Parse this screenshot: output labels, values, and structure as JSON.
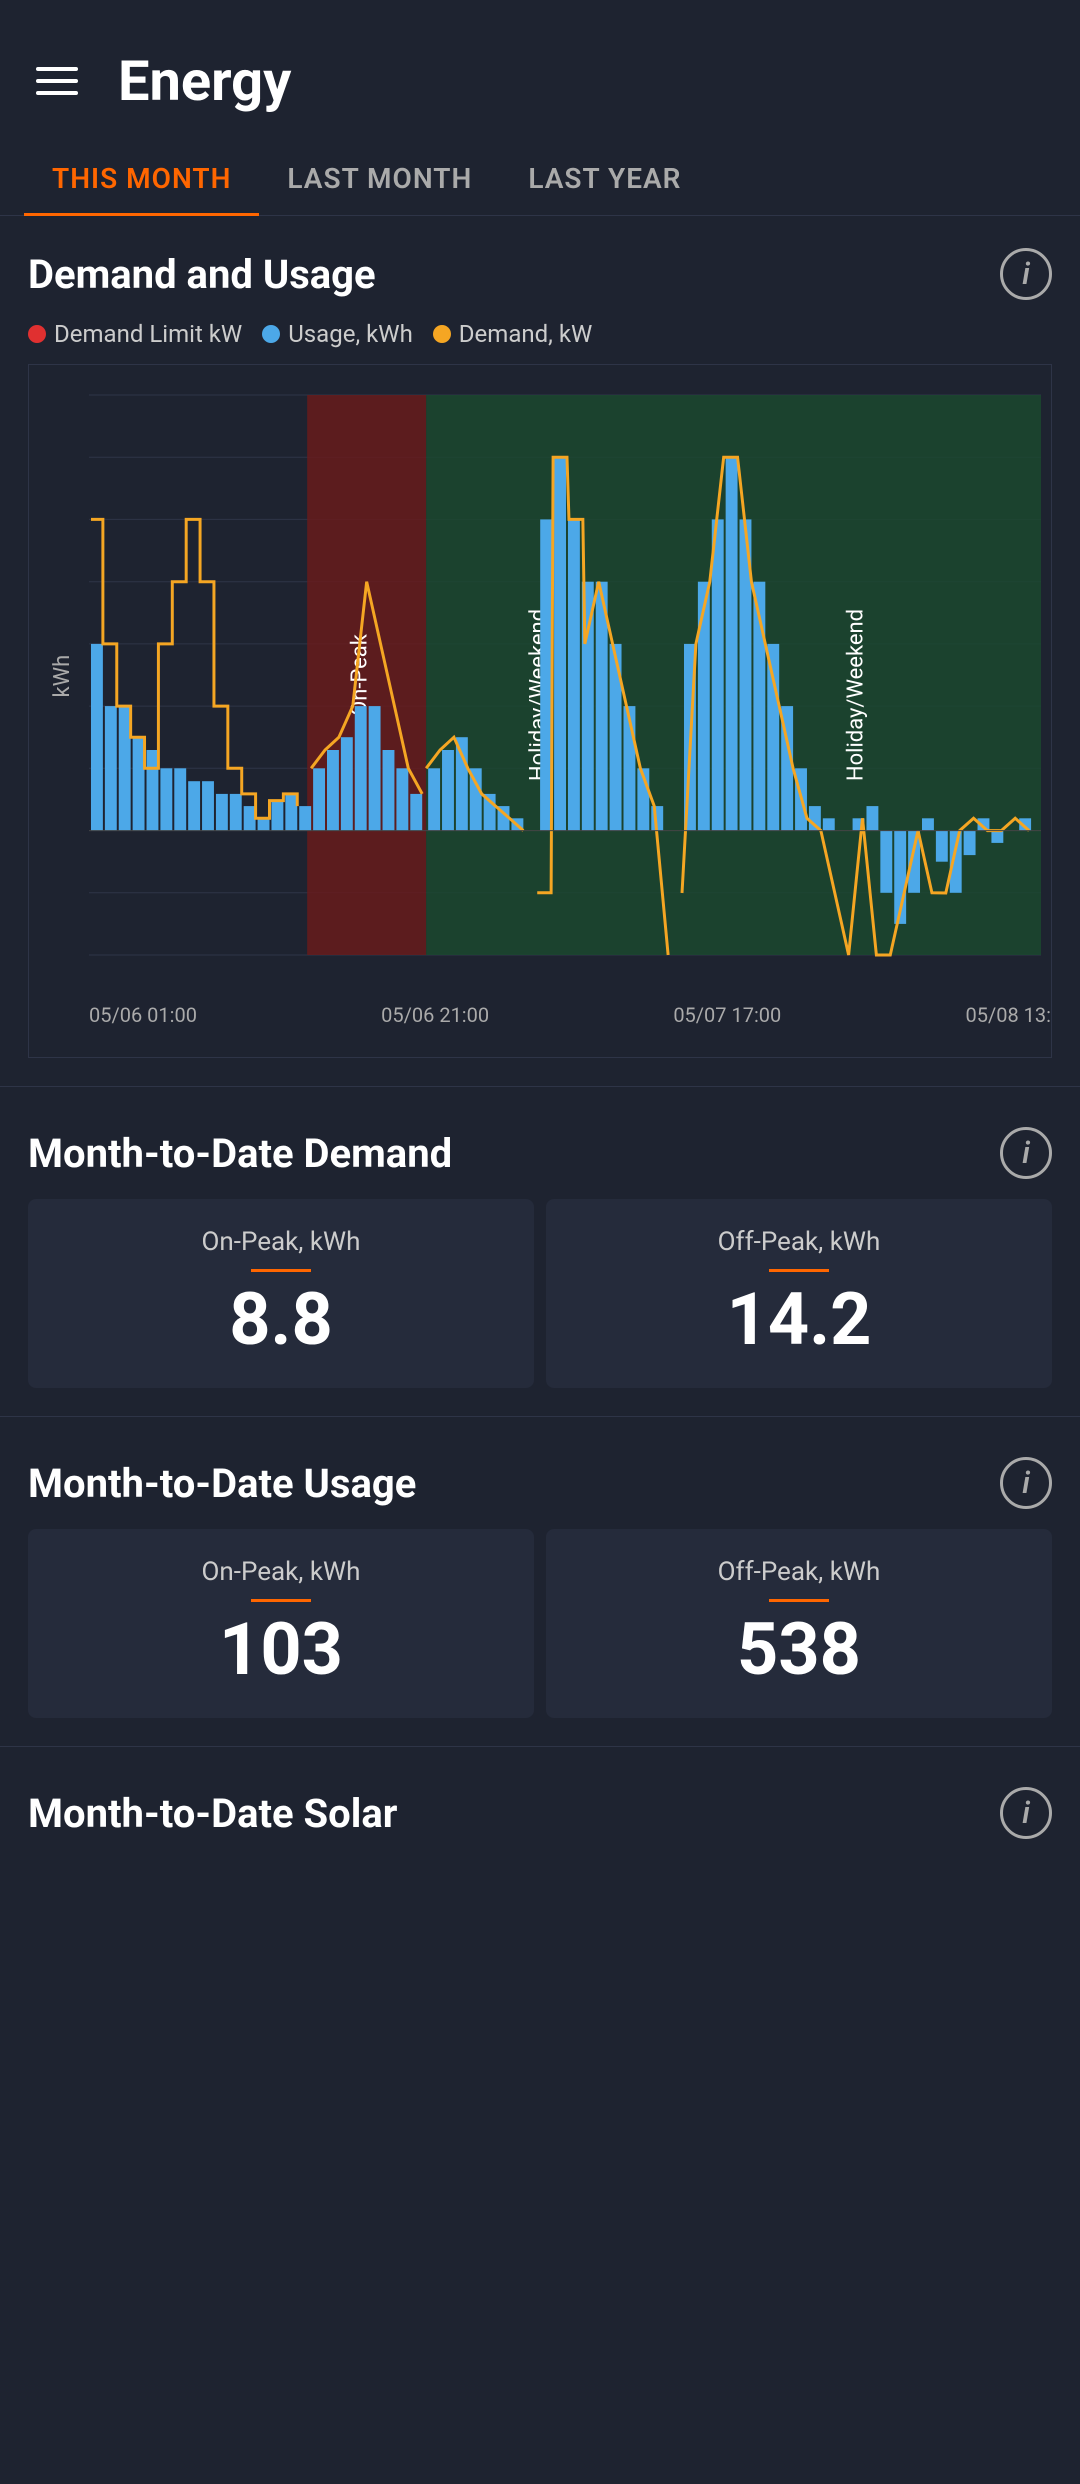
{
  "header": {
    "title": "Energy"
  },
  "tabs": [
    {
      "id": "this-month",
      "label": "THIS MONTH",
      "active": true
    },
    {
      "id": "last-month",
      "label": "LAST MONTH",
      "active": false
    },
    {
      "id": "last-year",
      "label": "LAST YEAR",
      "active": false
    }
  ],
  "demand_usage": {
    "title": "Demand and Usage",
    "legend": [
      {
        "label": "Demand Limit kW",
        "color": "#e03030"
      },
      {
        "label": "Usage, kWh",
        "color": "#4ca8e8"
      },
      {
        "label": "Demand, kW",
        "color": "#f5a623"
      }
    ],
    "y_axis_label": "kWh",
    "x_axis_labels": [
      "05/06 01:00",
      "05/06 21:00",
      "05/07 17:00",
      "05/08 13:"
    ],
    "zone_labels": [
      "On-Peak",
      "Holiday/Weekend",
      "Holiday/Weekend"
    ]
  },
  "month_to_date_demand": {
    "title": "Month-to-Date Demand",
    "on_peak_label": "On-Peak, kWh",
    "on_peak_value": "8.8",
    "off_peak_label": "Off-Peak, kWh",
    "off_peak_value": "14.2"
  },
  "month_to_date_usage": {
    "title": "Month-to-Date Usage",
    "on_peak_label": "On-Peak, kWh",
    "on_peak_value": "103",
    "off_peak_label": "Off-Peak, kWh",
    "off_peak_value": "538"
  },
  "month_to_date_solar": {
    "title": "Month-to-Date Solar"
  },
  "icons": {
    "info": "i",
    "hamburger": "≡"
  }
}
